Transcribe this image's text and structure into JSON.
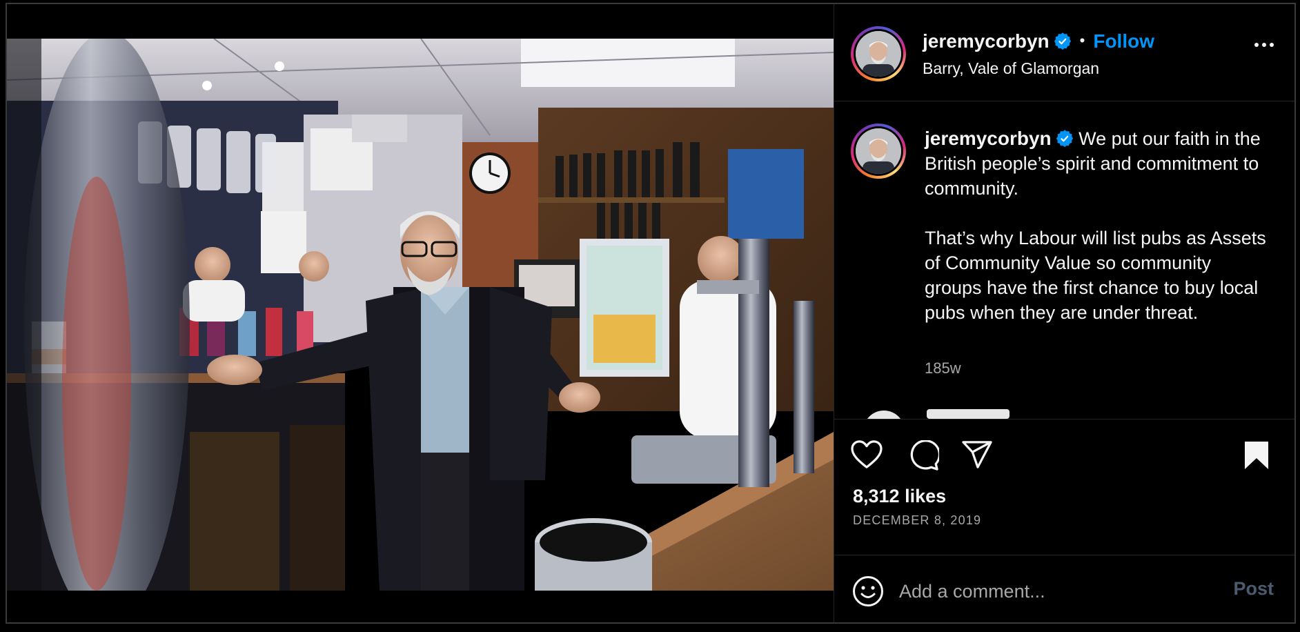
{
  "post": {
    "photo_alt": "Jeremy Corbyn standing behind a pub bar",
    "header": {
      "username": "jeremycorbyn",
      "separator": "•",
      "follow_label": "Follow",
      "location": "Barry, Vale of Glamorgan"
    },
    "caption": {
      "username": "jeremycorbyn",
      "text_line1": "We put our faith in the British people’s spirit and commitment to community.",
      "text_para2": "That’s why Labour will list pubs as Assets of Community Value so community groups have the first chance to buy local pubs when they are under threat.",
      "time": "185w"
    },
    "likes": "8,312 likes",
    "date": "DECEMBER 8, 2019",
    "comment_box": {
      "placeholder": "Add a comment...",
      "post_label": "Post"
    },
    "colors": {
      "accent": "#0095f6",
      "background": "#000000",
      "muted_text": "#a8a8a8",
      "post_disabled": "#4b5b70"
    },
    "icons": [
      "verified-badge-icon",
      "more-options-icon",
      "heart-icon",
      "comment-icon",
      "share-icon",
      "bookmark-icon",
      "emoji-icon"
    ]
  }
}
